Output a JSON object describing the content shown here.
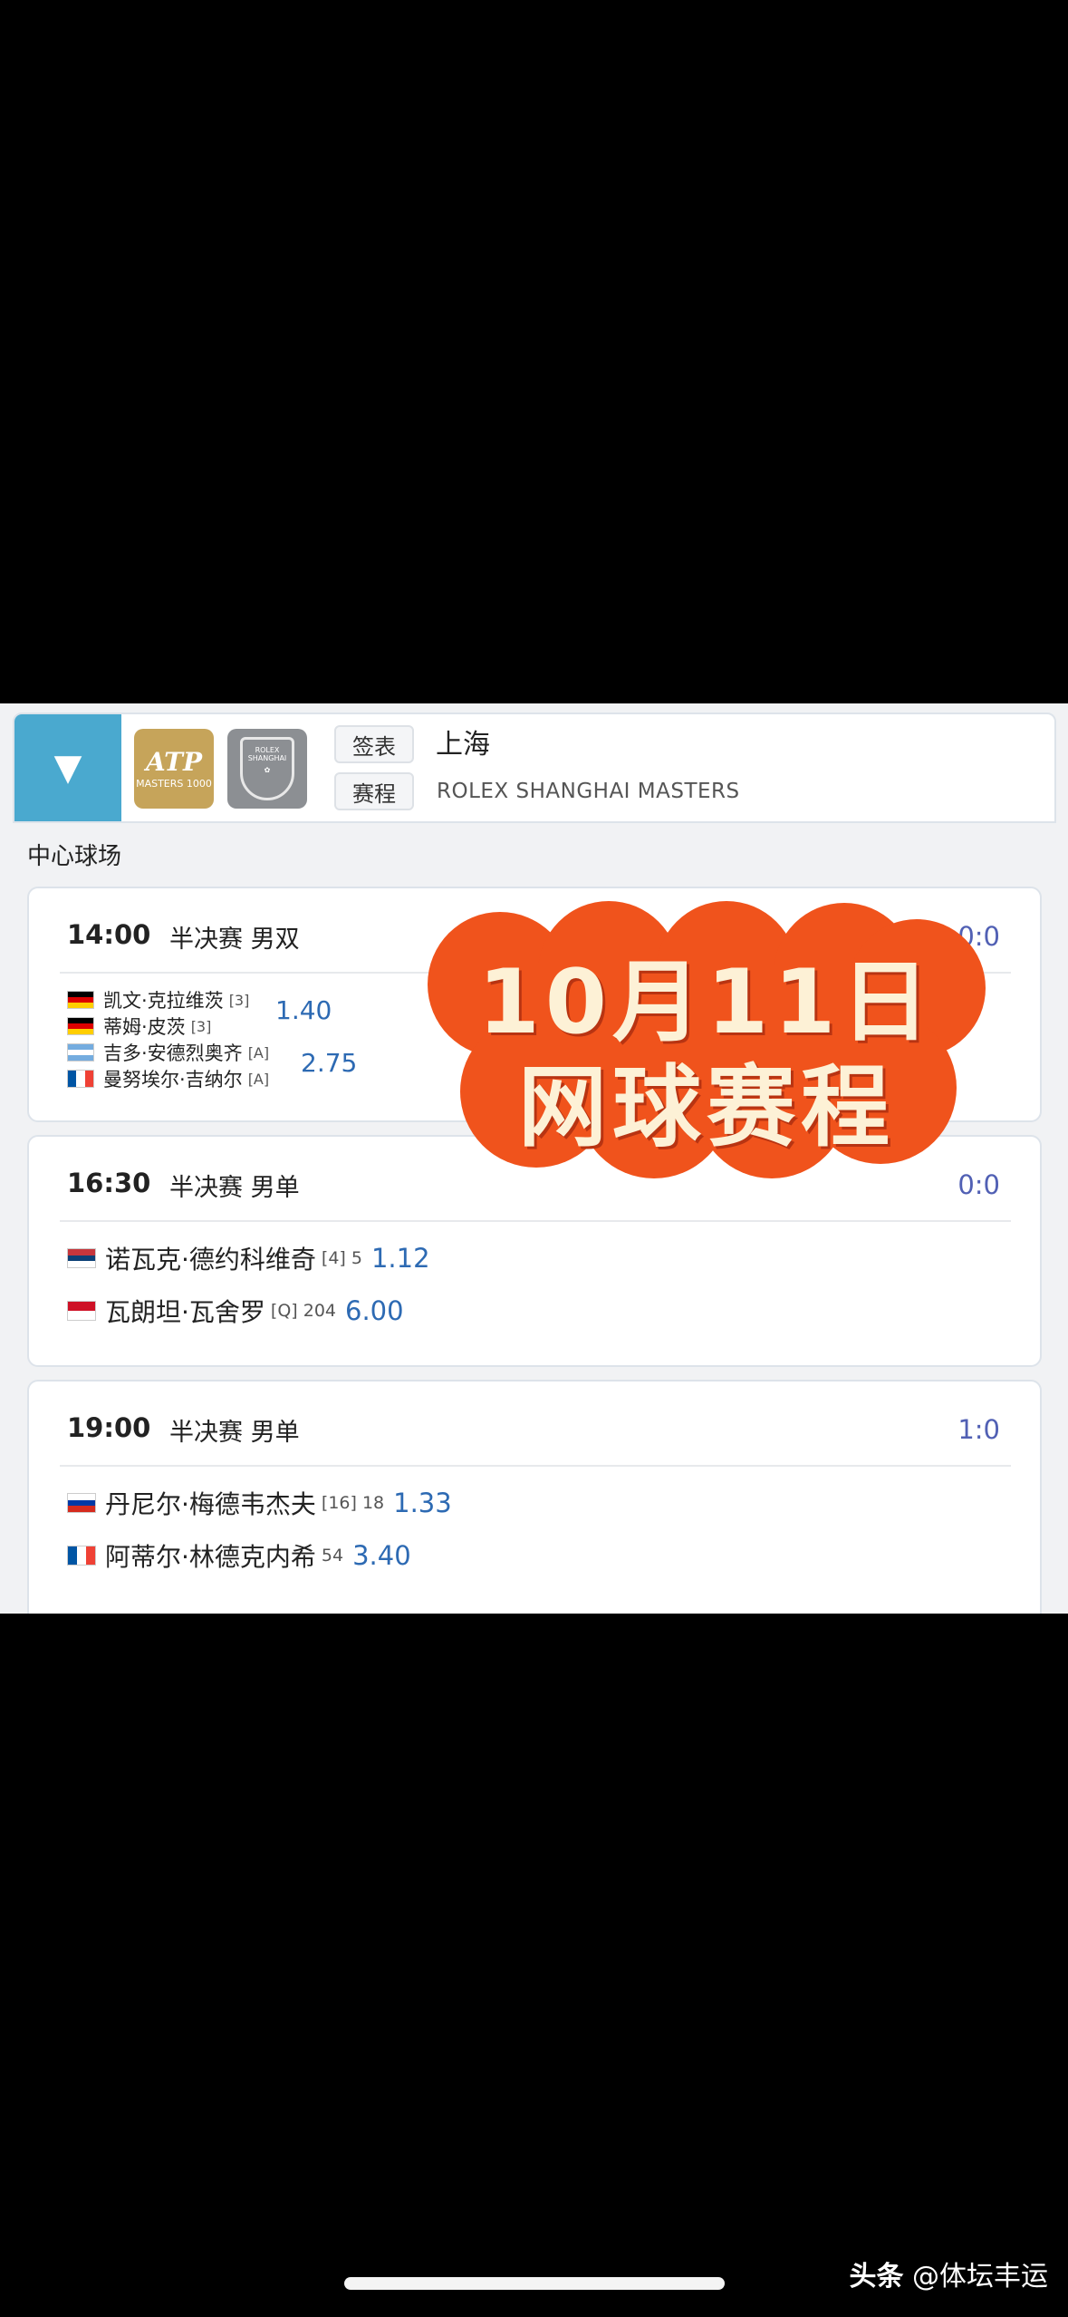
{
  "header": {
    "toggle_icon": "▼",
    "atp_logo": {
      "big": "ATP",
      "small": "MASTERS 1000"
    },
    "shanghai_logo": {
      "top": "ROLEX",
      "bottom": "SHANGHAI"
    },
    "draw_label": "签表",
    "schedule_label": "赛程",
    "city": "上海",
    "tournament": "ROLEX SHANGHAI MASTERS"
  },
  "court": "中心球场",
  "matches": [
    {
      "time": "14:00",
      "round": "半决赛 男双",
      "score": "0:0",
      "players": [
        {
          "name": "凯文·克拉维茨",
          "seed": "[3]",
          "country": "germany"
        },
        {
          "name": "蒂姆·皮茨",
          "seed": "[3]",
          "country": "germany"
        },
        {
          "name": "吉多·安德烈奥齐",
          "seed": "[A]",
          "country": "argentina"
        },
        {
          "name": "曼努埃尔·吉纳尔",
          "seed": "[A]",
          "country": "france"
        }
      ],
      "odds": [
        "1.40",
        "2.75"
      ]
    },
    {
      "time": "16:30",
      "round": "半决赛 男单",
      "score": "0:0",
      "players": [
        {
          "name": "诺瓦克·德约科维奇",
          "seed": "[4] 5",
          "odds": "1.12",
          "country": "serbia"
        },
        {
          "name": "瓦朗坦·瓦舍罗",
          "seed": "[Q] 204",
          "odds": "6.00",
          "country": "monaco"
        }
      ]
    },
    {
      "time": "19:00",
      "round": "半决赛 男单",
      "score": "1:0",
      "players": [
        {
          "name": "丹尼尔·梅德韦杰夫",
          "seed": "[16] 18",
          "odds": "1.33",
          "country": "russia"
        },
        {
          "name": "阿蒂尔·林德克内希",
          "seed": "54",
          "odds": "3.40",
          "country": "france"
        }
      ]
    }
  ],
  "overlay": {
    "line1": "10月11日",
    "line2": "网球赛程",
    "color": "#f0531c"
  },
  "watermark": {
    "brand": "头条",
    "author": "@体坛丰运"
  },
  "colors": {
    "accent": "#4aa9cf",
    "odds": "#2d6ab3",
    "score": "#5160b4",
    "atp_gold": "#c6a45a"
  }
}
